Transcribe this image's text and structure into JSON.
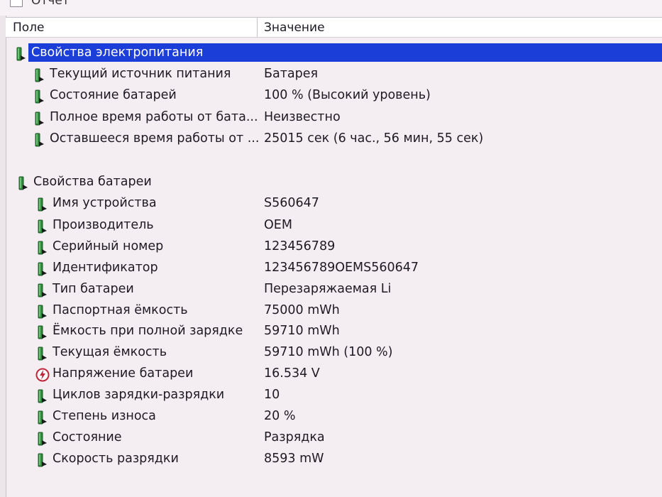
{
  "window": {
    "title": "Отчет"
  },
  "header": {
    "field": "Поле",
    "value": "Значение"
  },
  "groups": [
    {
      "label": "Свойства электропитания",
      "selected": true,
      "items": [
        {
          "field": "Текущий источник питания",
          "value": "Батарея",
          "icon": "battery-icon"
        },
        {
          "field": "Состояние батарей",
          "value": "100 % (Высокий уровень)",
          "icon": "battery-icon"
        },
        {
          "field": "Полное время работы от бата...",
          "value": "Неизвестно",
          "icon": "battery-icon"
        },
        {
          "field": "Оставшееся время работы от ...",
          "value": "25015 сек (6 час., 56 мин, 55 сек)",
          "icon": "battery-icon"
        }
      ]
    },
    {
      "label": "Свойства батареи",
      "selected": false,
      "items": [
        {
          "field": "Имя устройства",
          "value": "S560647",
          "icon": "battery-icon"
        },
        {
          "field": "Производитель",
          "value": "OEM",
          "icon": "battery-icon"
        },
        {
          "field": "Серийный номер",
          "value": "123456789",
          "icon": "battery-icon"
        },
        {
          "field": "Идентификатор",
          "value": "123456789OEMS560647",
          "icon": "battery-icon"
        },
        {
          "field": "Тип батареи",
          "value": "Перезаряжаемая Li",
          "icon": "battery-icon"
        },
        {
          "field": "Паспортная ёмкость",
          "value": "75000 mWh",
          "icon": "battery-icon"
        },
        {
          "field": "Ёмкость при полной зарядке",
          "value": "59710 mWh",
          "icon": "battery-icon"
        },
        {
          "field": "Текущая ёмкость",
          "value": "59710 mWh  (100 %)",
          "icon": "battery-icon"
        },
        {
          "field": "Напряжение батареи",
          "value": "16.534 V",
          "icon": "voltage-icon"
        },
        {
          "field": "Циклов зарядки-разрядки",
          "value": "10",
          "icon": "battery-icon"
        },
        {
          "field": "Степень износа",
          "value": "20 %",
          "icon": "battery-icon"
        },
        {
          "field": "Состояние",
          "value": "Разрядка",
          "icon": "battery-icon"
        },
        {
          "field": "Скорость разрядки",
          "value": "8593 mW",
          "icon": "battery-icon"
        }
      ]
    }
  ],
  "colors": {
    "selection": "#1c3ed8",
    "battery_green": "#2f8a3a",
    "voltage_red": "#c0263a"
  }
}
